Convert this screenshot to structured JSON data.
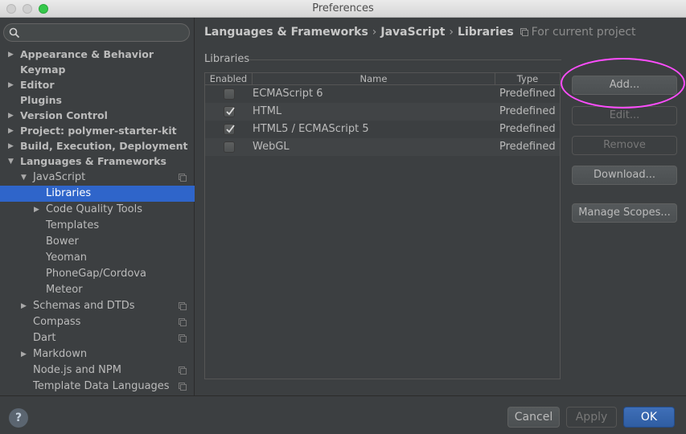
{
  "window": {
    "title": "Preferences"
  },
  "search": {
    "placeholder": ""
  },
  "sidebar": {
    "items": [
      {
        "label": "Appearance & Behavior",
        "arrow": "▶"
      },
      {
        "label": "Keymap",
        "arrow": ""
      },
      {
        "label": "Editor",
        "arrow": "▶"
      },
      {
        "label": "Plugins",
        "arrow": ""
      },
      {
        "label": "Version Control",
        "arrow": "▶"
      },
      {
        "label": "Project: polymer-starter-kit",
        "arrow": "▶"
      },
      {
        "label": "Build, Execution, Deployment",
        "arrow": "▶"
      },
      {
        "label": "Languages & Frameworks",
        "arrow": "▼"
      },
      {
        "label": "JavaScript",
        "arrow": "▼"
      },
      {
        "label": "Libraries",
        "arrow": ""
      },
      {
        "label": "Code Quality Tools",
        "arrow": "▶"
      },
      {
        "label": "Templates",
        "arrow": ""
      },
      {
        "label": "Bower",
        "arrow": ""
      },
      {
        "label": "Yeoman",
        "arrow": ""
      },
      {
        "label": "PhoneGap/Cordova",
        "arrow": ""
      },
      {
        "label": "Meteor",
        "arrow": ""
      },
      {
        "label": "Schemas and DTDs",
        "arrow": "▶"
      },
      {
        "label": "Compass",
        "arrow": ""
      },
      {
        "label": "Dart",
        "arrow": ""
      },
      {
        "label": "Markdown",
        "arrow": "▶"
      },
      {
        "label": "Node.js and NPM",
        "arrow": ""
      },
      {
        "label": "Template Data Languages",
        "arrow": ""
      }
    ],
    "selected_color": "#2f65ca"
  },
  "breadcrumb": {
    "parts": [
      "Languages & Frameworks",
      "JavaScript",
      "Libraries"
    ],
    "separator": "›",
    "scope": "For current project"
  },
  "libraries": {
    "group_label": "Libraries",
    "headers": {
      "enabled": "Enabled",
      "name": "Name",
      "type": "Type"
    },
    "rows": [
      {
        "enabled": false,
        "name": "ECMAScript 6",
        "type": "Predefined"
      },
      {
        "enabled": true,
        "name": "HTML",
        "type": "Predefined"
      },
      {
        "enabled": true,
        "name": "HTML5 / ECMAScript 5",
        "type": "Predefined"
      },
      {
        "enabled": false,
        "name": "WebGL",
        "type": "Predefined"
      }
    ]
  },
  "actions": {
    "add": "Add...",
    "edit": "Edit...",
    "remove": "Remove",
    "download": "Download...",
    "manage_scopes": "Manage Scopes..."
  },
  "footer": {
    "help": "?",
    "cancel": "Cancel",
    "apply": "Apply",
    "ok": "OK"
  },
  "colors": {
    "annotation": "#ff4dff",
    "primary": "#2f5da2"
  }
}
